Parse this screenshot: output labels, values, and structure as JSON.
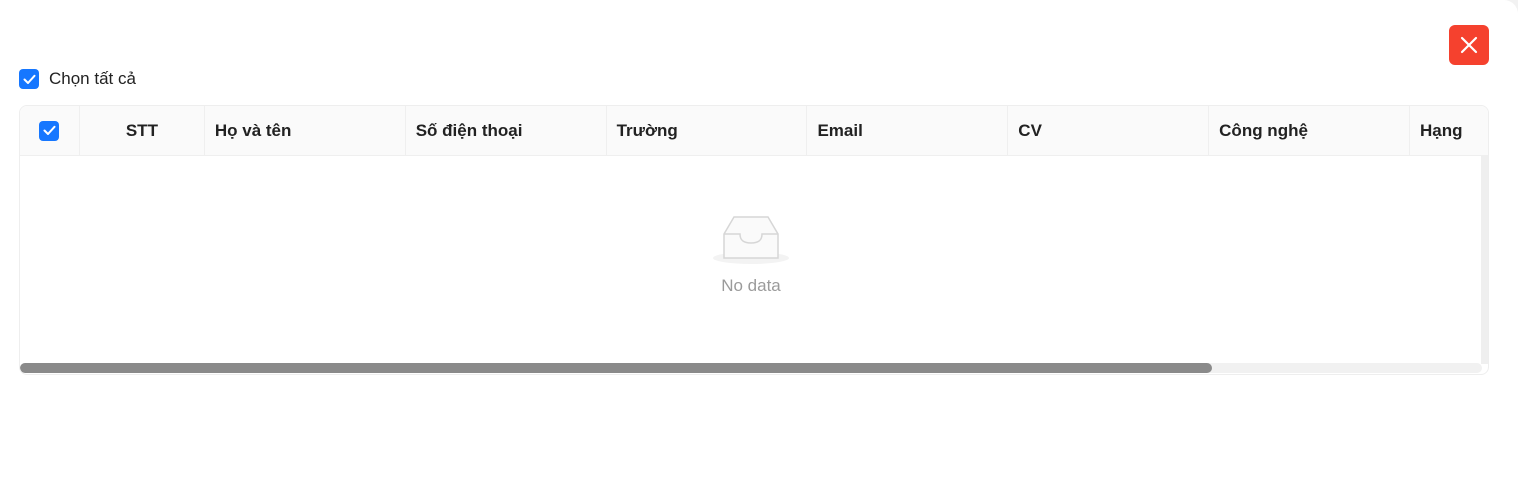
{
  "modal": {
    "close_icon": "close-icon"
  },
  "select_all": {
    "label": "Chọn tất cả",
    "checked": true
  },
  "table": {
    "columns": [
      "STT",
      "Họ và tên",
      "Số điện thoại",
      "Trường",
      "Email",
      "CV",
      "Công nghệ",
      "Hạng"
    ],
    "rows": [],
    "header_checkbox_checked": true,
    "empty_text": "No data",
    "empty_icon": "empty-inbox-icon",
    "horizontal_scroll_position": 0,
    "horizontal_scroll_visible_fraction": 0.815
  },
  "colors": {
    "accent": "#1677ff",
    "danger": "#f5412e",
    "scroll_thumb": "#8a8a8a"
  }
}
